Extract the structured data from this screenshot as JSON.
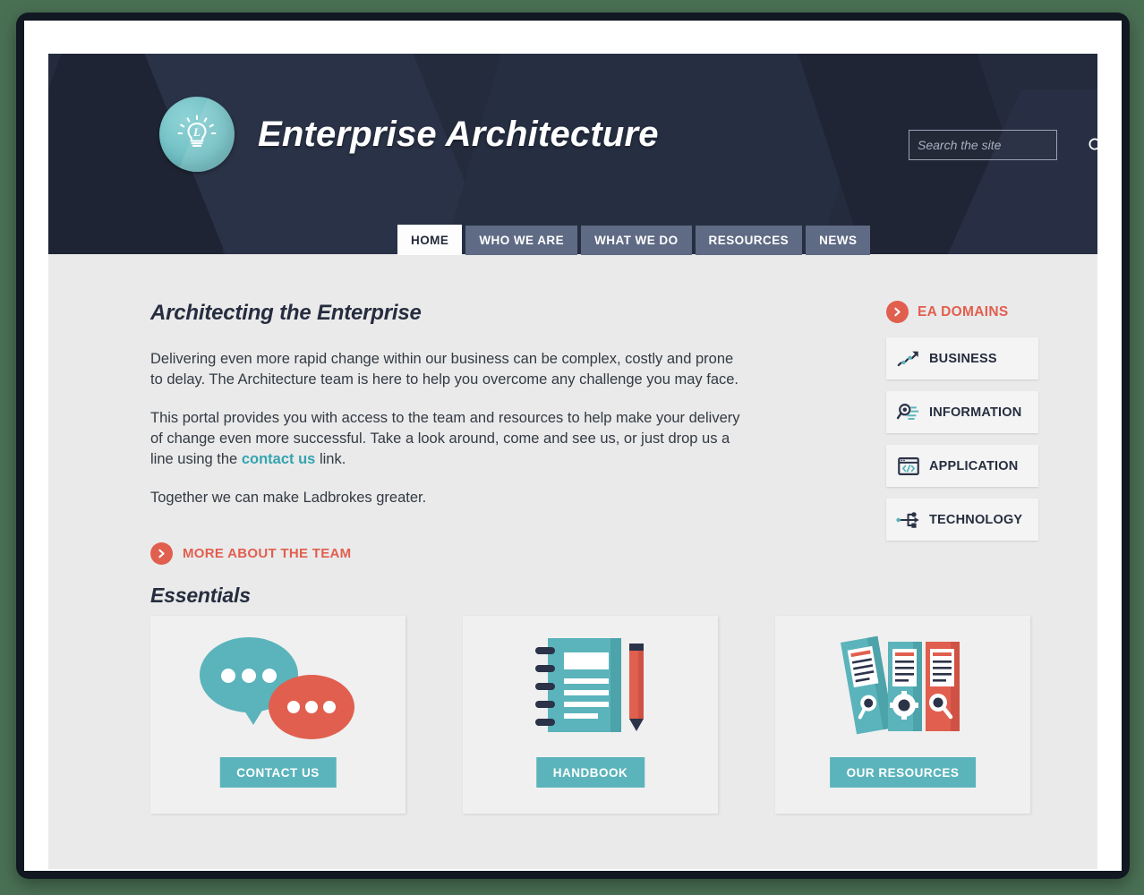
{
  "header": {
    "site_title": "Enterprise Architecture",
    "logo_letter": "L",
    "logo_icon": "lightbulb-icon",
    "search": {
      "placeholder": "Search the site",
      "value": "",
      "icon": "search-icon"
    }
  },
  "nav": {
    "items": [
      {
        "label": "HOME",
        "active": true
      },
      {
        "label": "WHO WE ARE",
        "active": false
      },
      {
        "label": "WHAT WE DO",
        "active": false
      },
      {
        "label": "RESOURCES",
        "active": false
      },
      {
        "label": "NEWS",
        "active": false
      }
    ]
  },
  "main": {
    "heading": "Architecting the Enterprise",
    "paragraph_1": "Delivering even more rapid change within our business can be complex, costly and prone to delay. The Architecture team is here to help you overcome any challenge you may face.",
    "paragraph_2_before": "This portal provides you with access to the team and resources to help make your delivery of change even more successful. Take a look around, come and see us, or just drop us a line using the ",
    "paragraph_2_link": "contact us",
    "paragraph_2_after": " link.",
    "paragraph_3": "Together we can make Ladbrokes greater.",
    "more_link": "MORE ABOUT THE TEAM",
    "more_link_icon": "chevron-right-circle-icon"
  },
  "domains": {
    "title": "EA DOMAINS",
    "title_icon": "chevron-right-circle-icon",
    "items": [
      {
        "label": "BUSINESS",
        "icon": "trending-arrow-icon"
      },
      {
        "label": "INFORMATION",
        "icon": "magnifier-lines-icon"
      },
      {
        "label": "APPLICATION",
        "icon": "browser-code-icon"
      },
      {
        "label": "TECHNOLOGY",
        "icon": "network-node-icon"
      }
    ]
  },
  "essentials": {
    "heading": "Essentials",
    "cards": [
      {
        "cta": "CONTACT US",
        "art": "speech-bubbles-art"
      },
      {
        "cta": "HANDBOOK",
        "art": "notebook-pencil-art"
      },
      {
        "cta": "OUR RESOURCES",
        "art": "binders-art"
      }
    ]
  },
  "colors": {
    "header_navy": "#242b3d",
    "teal": "#5bb4bb",
    "coral": "#e15f4f",
    "content_bg": "#eaeaea",
    "nav_inactive": "#5f6a84",
    "link_teal": "#35a4b0"
  }
}
